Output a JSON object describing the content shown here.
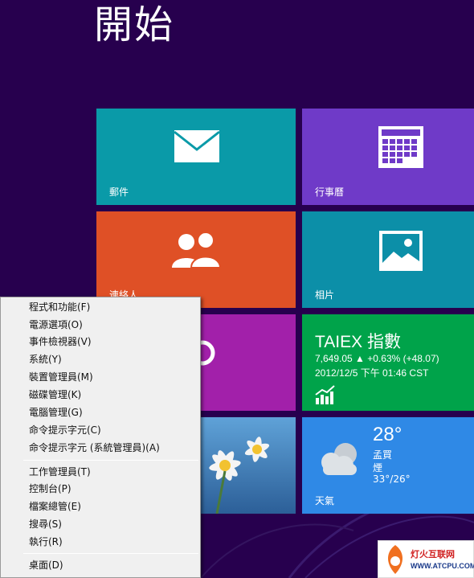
{
  "start": {
    "title": "開始"
  },
  "tiles": {
    "mail": {
      "label": "郵件",
      "color": "#0a9aa8"
    },
    "calendar": {
      "label": "行事曆",
      "color": "#6f3ac8"
    },
    "people": {
      "label": "連絡人",
      "color": "#df5026"
    },
    "photos": {
      "label": "相片",
      "color": "#0c8fa8"
    },
    "finance": {
      "title": "TAIEX 指數",
      "value_line": "7,649.05 ▲ +0.63% (+48.07)",
      "time_line": "2012/12/5 下午 01:46 CST",
      "color": "#00a34a"
    },
    "weather": {
      "temperature": "28°",
      "city": "孟買",
      "condition": "煙",
      "range": "33°/26°",
      "label": "天氣",
      "color": "#2f89e6"
    }
  },
  "context_menu": {
    "items": [
      {
        "label": "程式和功能(F)"
      },
      {
        "label": "電源選項(O)"
      },
      {
        "label": "事件檢視器(V)"
      },
      {
        "label": "系統(Y)"
      },
      {
        "label": "裝置管理員(M)"
      },
      {
        "label": "磁碟管理(K)"
      },
      {
        "label": "電腦管理(G)"
      },
      {
        "label": "命令提示字元(C)"
      },
      {
        "label": "命令提示字元 (系統管理員)(A)"
      },
      {
        "label": "工作管理員(T)"
      },
      {
        "label": "控制台(P)"
      },
      {
        "label": "檔案總管(E)"
      },
      {
        "label": "搜尋(S)"
      },
      {
        "label": "執行(R)"
      },
      {
        "label": "桌面(D)"
      }
    ]
  },
  "watermark": {
    "name": "灯火互联网",
    "url": "WWW.ATCPU.COM"
  },
  "icons": [
    "mail-icon",
    "calendar-icon",
    "people-icon",
    "photos-icon",
    "finance-chart-icon",
    "weather-cloud-icon",
    "flower-image"
  ]
}
